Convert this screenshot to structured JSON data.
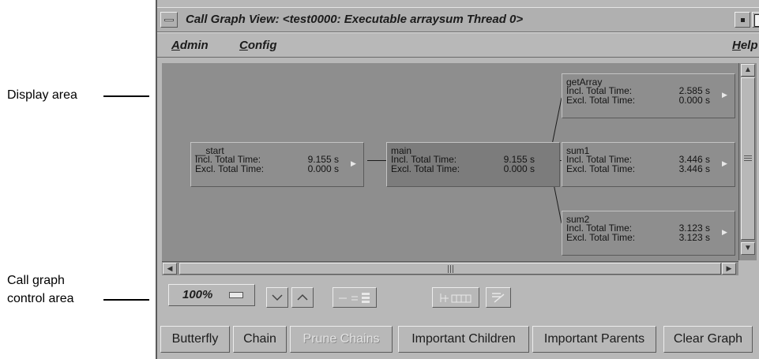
{
  "callouts": {
    "display_area": "Display area",
    "control_area_line1": "Call graph",
    "control_area_line2": "control area"
  },
  "window": {
    "title": "Call Graph View: <test0000: Executable arraysum Thread 0>"
  },
  "menubar": {
    "admin": "Admin",
    "config": "Config",
    "help": "Help"
  },
  "nodes": [
    {
      "name": "__start",
      "incl_label": "Incl. Total Time:",
      "incl_value": "9.155 s",
      "excl_label": "Excl. Total Time:",
      "excl_value": "0.000 s"
    },
    {
      "name": "main",
      "incl_label": "Incl. Total Time:",
      "incl_value": "9.155 s",
      "excl_label": "Excl. Total Time:",
      "excl_value": "0.000 s"
    },
    {
      "name": "getArray",
      "incl_label": "Incl. Total Time:",
      "incl_value": "2.585 s",
      "excl_label": "Excl. Total Time:",
      "excl_value": "0.000 s"
    },
    {
      "name": "sum1",
      "incl_label": "Incl. Total Time:",
      "incl_value": "3.446 s",
      "excl_label": "Excl. Total Time:",
      "excl_value": "3.446 s"
    },
    {
      "name": "sum2",
      "incl_label": "Incl. Total Time:",
      "incl_value": "3.123 s",
      "excl_label": "Excl. Total Time:",
      "excl_value": "3.123 s"
    }
  ],
  "controls": {
    "zoom": "100%"
  },
  "buttons": {
    "butterfly": "Butterfly",
    "chain": "Chain",
    "prune_chains": "Prune Chains",
    "important_children": "Important Children",
    "important_parents": "Important Parents",
    "clear_graph": "Clear Graph"
  },
  "colors": {
    "window_bg": "#b8b8b8",
    "display_bg": "#8e8e8e",
    "selected_node_bg": "#7c7c7c"
  }
}
